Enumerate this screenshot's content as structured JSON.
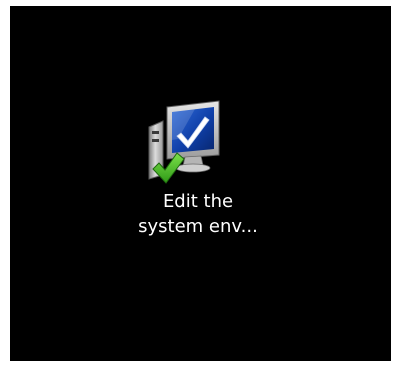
{
  "desktop": {
    "background": "#000000",
    "icon": {
      "icon_name": "system-properties-icon",
      "label_line1": "Edit the",
      "label_line2": "system env...",
      "label_color": "#ffffff"
    }
  }
}
